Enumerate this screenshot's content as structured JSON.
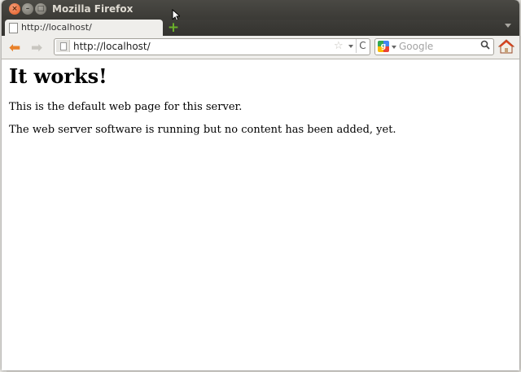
{
  "window": {
    "title": "Mozilla Firefox",
    "close_glyph": "×",
    "min_glyph": "–",
    "max_glyph": "□"
  },
  "tabs": [
    {
      "label": "http://localhost/"
    }
  ],
  "toolbar": {
    "new_tab_glyph": "+",
    "back_glyph": "⬅",
    "forward_glyph": "➡"
  },
  "urlbar": {
    "value": "http://localhost/",
    "star_glyph": "☆",
    "reload_glyph": "C"
  },
  "search": {
    "placeholder": "Google",
    "engine_glyph": "g",
    "search_glyph": "🔍"
  },
  "page": {
    "heading": "It works!",
    "paragraphs": [
      "This is the default web page for this server.",
      "The web server software is running but no content has been added, yet."
    ]
  },
  "colors": {
    "titlebar": "#3b3a36",
    "back_arrow": "#e8812a",
    "home_roof": "#d9431e"
  },
  "icons": [
    "close-icon",
    "minimize-icon",
    "maximize-icon",
    "page-icon",
    "new-tab-icon",
    "back-icon",
    "forward-icon",
    "bookmark-star-icon",
    "reload-icon",
    "google-icon",
    "search-icon",
    "home-icon"
  ]
}
